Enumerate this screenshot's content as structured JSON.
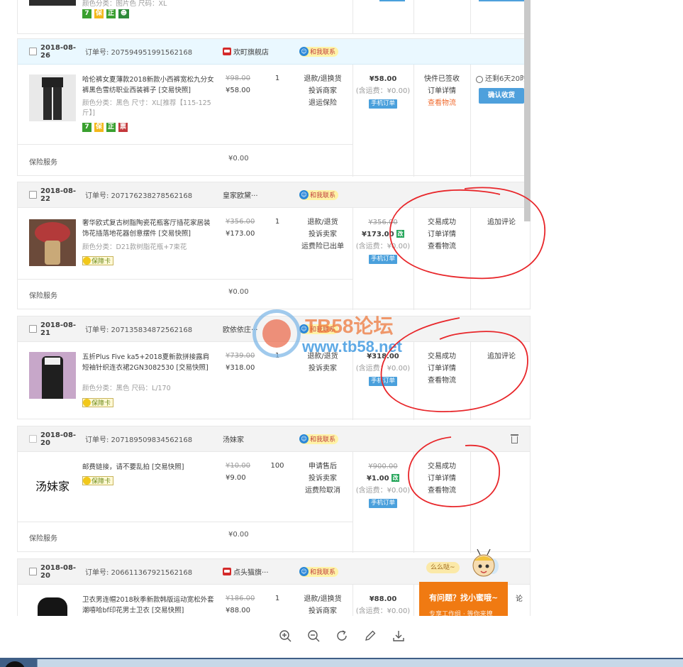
{
  "top_partial": {
    "sku_text": "颜色分类：图片色  尺码：XL",
    "tags": [
      "7",
      "保",
      "正",
      "cert"
    ]
  },
  "contact_label": "和我联系",
  "insurance_label": "保险服务",
  "insurance_value": "¥0.00",
  "orders": [
    {
      "date": "2018-08-26",
      "order_no": "订单号: 207594951991562168",
      "shop": "欢町旗舰店",
      "title": "哈伦裤女夏薄款2018新款小西裤宽松九分女裤黑色雪纺职业西装裤子 [交易快照]",
      "sku": "颜色分类：黑色  尺寸：XL[推荐【115-125斤】]",
      "price_old": "¥98.00",
      "price_now": "¥58.00",
      "qty": "1",
      "services": [
        "退款/退换货",
        "投诉商家",
        "退运保险"
      ],
      "total": "¥58.00",
      "freight": "(含运费：¥0.00)",
      "mobile": "手机订单",
      "status": [
        "快件已签收",
        "订单详情",
        "查看物流"
      ],
      "timer": "还剩6天20时",
      "action_btn": "确认收货"
    },
    {
      "date": "2018-08-22",
      "order_no": "订单号: 207176238278562168",
      "shop": "皇家欧黛···",
      "title": "奢华欧式复古树脂陶瓷花瓶客厅插花家居装饰花插落地花器创意摆件 [交易快照]",
      "sku": "颜色分类：D21款树脂花瓶+7束花",
      "cert": "保障卡",
      "price_old": "¥356.00",
      "price_now": "¥173.00",
      "qty": "1",
      "services": [
        "退款/退货",
        "投诉卖家",
        "运费险已出单"
      ],
      "total_old": "¥356.00",
      "total": "¥173.00",
      "mod": "改",
      "freight": "(含运费：¥0.00)",
      "mobile": "手机订单",
      "status": [
        "交易成功",
        "订单详情",
        "查看物流"
      ],
      "action": "追加评论"
    },
    {
      "date": "2018-08-21",
      "order_no": "订单号: 207135834872562168",
      "shop": "欧依依庄···",
      "title": "五折Plus Five ka5+2018夏新款拼接露肩短袖针织连衣裙2GN3082530 [交易快照]",
      "sku": "颜色分类：黑色  尺码：L/170",
      "cert": "保障卡",
      "price_old": "¥739.00",
      "price_now": "¥318.00",
      "qty": "1",
      "services": [
        "退款/退货",
        "投诉卖家"
      ],
      "total": "¥318.00",
      "freight": "(含运费：¥0.00)",
      "mobile": "手机订单",
      "status": [
        "交易成功",
        "订单详情",
        "查看物流"
      ],
      "action": "追加评论"
    },
    {
      "date": "2018-08-20",
      "order_no": "订单号: 207189509834562168",
      "shop": "汤妹家",
      "thumb_text": "汤妹家",
      "title": "邮费链接，请不要乱拍 [交易快照]",
      "cert": "保障卡",
      "price_old": "¥10.00",
      "price_now": "¥9.00",
      "qty": "100",
      "services": [
        "申请售后",
        "投诉卖家",
        "运费险取消"
      ],
      "total_old": "¥900.00",
      "total": "¥1.00",
      "mod": "改",
      "freight": "(含运费：¥0.00)",
      "mobile": "手机订单",
      "status": [
        "交易成功",
        "订单详情",
        "查看物流"
      ]
    },
    {
      "date": "2018-08-20",
      "order_no": "订单号: 206611367921562168",
      "shop": "点头猫旗···",
      "title": "卫衣男连帽2018秋季新款韩版运动宽松外套潮嘻哈bf印花男士卫衣 [交易快照]",
      "price_old": "¥186.00",
      "price_now": "¥88.00",
      "qty": "1",
      "services": [
        "退款/退换货",
        "投诉商家"
      ],
      "total": "¥88.00",
      "freight": "(含运费：¥0.00)",
      "action": "论"
    }
  ],
  "watermark": {
    "line1": "TB58论坛",
    "line2": "www.tb58.net"
  },
  "helper": {
    "bubble": "么么哒~",
    "panel": "有问题？找小蜜哦~",
    "panel_sub": "专享工作组 · 等你来撩"
  },
  "toolbar": {
    "zoom_in": "zoom-in",
    "zoom_out": "zoom-out",
    "rotate": "rotate",
    "edit": "edit",
    "download": "download"
  }
}
